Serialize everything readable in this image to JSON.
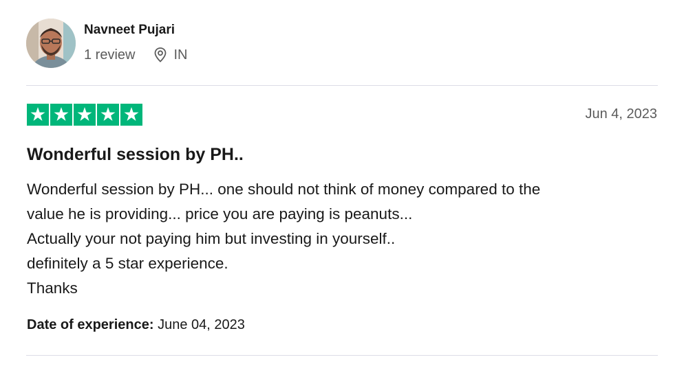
{
  "reviewer": {
    "name": "Navneet Pujari",
    "review_count": "1 review",
    "country": "IN",
    "location_icon": "location-pin-icon"
  },
  "review": {
    "rating": 5,
    "max_rating": 5,
    "star_color": "#00b67a",
    "date": "Jun 4, 2023",
    "title": "Wonderful session by PH..",
    "body_lines": [
      "Wonderful session by PH... one should not think of money compared to the",
      "value he is providing... price you are paying is peanuts...",
      "Actually your not paying him but investing in yourself..",
      "definitely a 5 star experience.",
      "Thanks"
    ],
    "experience_label": "Date of experience:",
    "experience_date": "June 04, 2023"
  }
}
